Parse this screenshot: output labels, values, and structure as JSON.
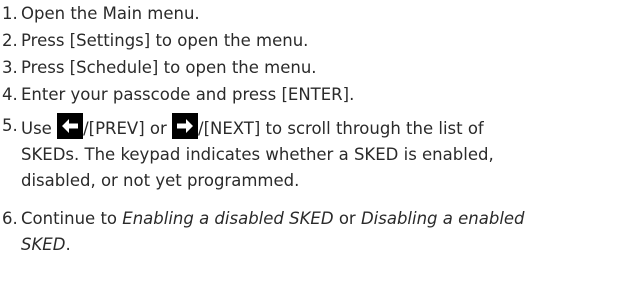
{
  "steps": [
    {
      "number": "1.",
      "text": "Open the Main menu."
    },
    {
      "number": "2.",
      "text": "Press [Settings] to open the menu."
    },
    {
      "number": "3.",
      "text": "Press [Schedule] to open the menu."
    },
    {
      "number": "4.",
      "text": "Enter your passcode and press [ENTER]."
    },
    {
      "number": "5.",
      "use": "Use",
      "prev_label": "/[PREV] or",
      "next_label": "/[NEXT] to scroll through the list of",
      "line2": "SKEDs. The keypad indicates whether a SKED is enabled,",
      "line3": "disabled, or not yet programmed."
    },
    {
      "number": "6.",
      "pre": "Continue to",
      "link1": "Enabling a disabled SKED",
      "mid": "or",
      "link2_line1": "Disabling a enabled",
      "link2_line2": "SKED",
      "end": "."
    }
  ],
  "icons": {
    "prev": "left-arrow-key-icon",
    "next": "right-arrow-key-icon"
  },
  "colors": {
    "text": "#2a2a2a",
    "icon_bg": "#000000",
    "icon_fg": "#ffffff"
  }
}
